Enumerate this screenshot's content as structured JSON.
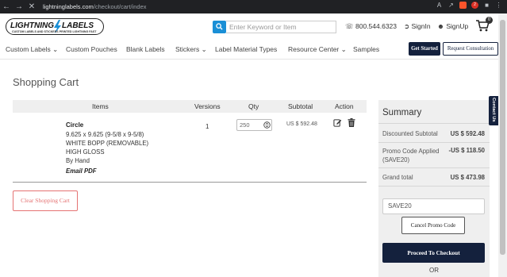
{
  "browser": {
    "url_host": "lightninglabels.com",
    "url_path": "/checkout/cart/index",
    "ext_badge": "2"
  },
  "header": {
    "logo_text": "LIGHTNING LABELS",
    "logo_tagline": "CUSTOM LABELS AND STICKERS  PRINTED LIGHTNING FAST",
    "search_placeholder": "Enter Keyword or Item",
    "phone": "800.544.6323",
    "signin": "SignIn",
    "signup": "SignUp",
    "cart_count": "0"
  },
  "nav": {
    "items": [
      "Custom Labels",
      "Custom Pouches",
      "Blank Labels",
      "Stickers",
      "Label Material Types",
      "Resource Center",
      "Samples"
    ],
    "get_started": "Get Started",
    "request_consultation": "Request Consultation"
  },
  "cart": {
    "title": "Shopping Cart",
    "columns": {
      "items": "Items",
      "versions": "Versions",
      "qty": "Qty",
      "subtotal": "Subtotal",
      "action": "Action"
    },
    "item": {
      "name": "Circle",
      "size": "9.625 x 9.625 (9-5/8 x 9-5/8)",
      "material": "WHITE BOPP (REMOVABLE)",
      "finish": "HIGH GLOSS",
      "delivery": "By Hand",
      "proof": "Email PDF",
      "versions": "1",
      "qty": "250",
      "subtotal": "US $ 592.48"
    },
    "clear_button": "Clear Shopping Cart"
  },
  "summary": {
    "title": "Summary",
    "discounted_subtotal_label": "Discounted Subtotal",
    "discounted_subtotal_value": "US $ 592.48",
    "promo_label": "Promo Code Applied (SAVE20)",
    "promo_value": "-US $ 118.50",
    "grand_total_label": "Grand total",
    "grand_total_value": "US $ 473.98",
    "promo_code_input": "SAVE20",
    "cancel_promo": "Cancel Promo Code",
    "checkout": "Proceed To Checkout",
    "or_text": "OR"
  },
  "contact_tab": "Contact Us",
  "colors": {
    "navy": "#14213d",
    "accent_blue": "#1a8fd6",
    "clear_red": "#e57373"
  }
}
